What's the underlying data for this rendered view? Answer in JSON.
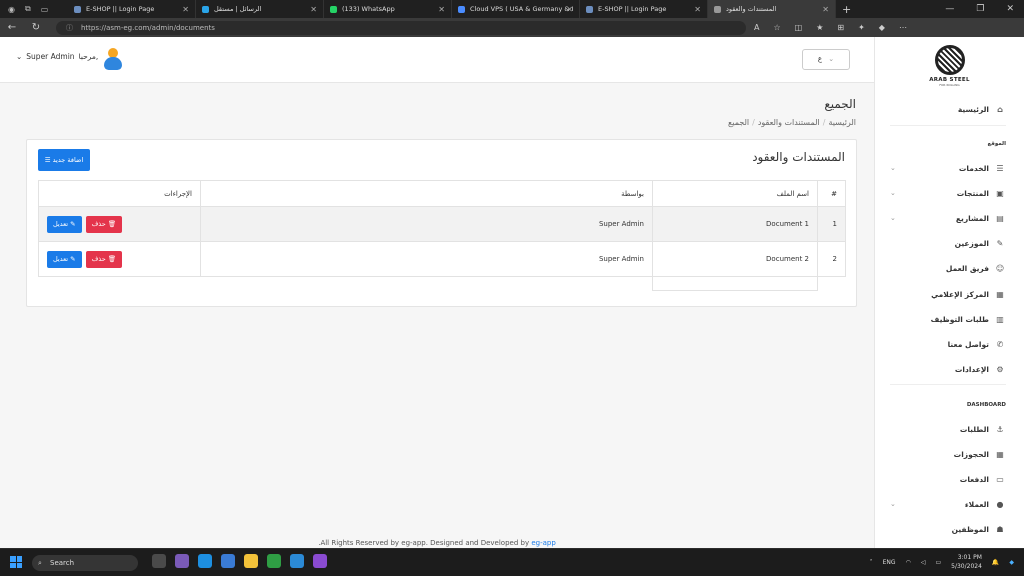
{
  "browser": {
    "tabs": [
      {
        "title": "E-SHOP || Login Page",
        "color": "#6c8ebf",
        "active": false
      },
      {
        "title": "الرسائل | مستقل",
        "color": "#2aa4e8",
        "active": false
      },
      {
        "title": "(133) WhatsApp",
        "color": "#25d366",
        "active": false
      },
      {
        "title": "Cloud VPS ( USA & Germany & I",
        "color": "#4a8cff",
        "active": false
      },
      {
        "title": "E-SHOP || Login Page",
        "color": "#6c8ebf",
        "active": false
      },
      {
        "title": "المستندات والعقود",
        "color": "#999999",
        "active": true
      }
    ],
    "url": "https://asm-eg.com/admin/documents"
  },
  "header": {
    "user_name": "Super Admin",
    "greeting": "مرحبا,",
    "language": "ع"
  },
  "page": {
    "title": "الجميع",
    "breadcrumb": [
      "الرئيسية",
      "المستندات والعقود",
      "الجميع"
    ]
  },
  "card": {
    "title": "المستندات والعقود",
    "add_button": "اضافة جديد",
    "columns": [
      "#",
      "اسم الملف",
      "بواسطة",
      "الإجراءات"
    ],
    "rows": [
      {
        "num": "1",
        "file": "Document 1",
        "by": "Super Admin",
        "edit": "تعديل",
        "delete": "حذف"
      },
      {
        "num": "2",
        "file": "Document 2",
        "by": "Super Admin",
        "edit": "تعديل",
        "delete": "حذف"
      }
    ]
  },
  "sidebar": {
    "logo_name": "ARAB STEEL",
    "logo_sub": "FOR ROLLING",
    "home": "الرئيسية",
    "section_site": "الموقع",
    "items": [
      {
        "label": "الخدمات",
        "icon": "list-icon",
        "glyph": "☰",
        "chevron": true
      },
      {
        "label": "المنتجات",
        "icon": "box-icon",
        "glyph": "▣",
        "chevron": true
      },
      {
        "label": "المشاريع",
        "icon": "briefcase-icon",
        "glyph": "▤",
        "chevron": true
      },
      {
        "label": "الموزعين",
        "icon": "pen-icon",
        "glyph": "✎",
        "chevron": false
      },
      {
        "label": "فريق العمل",
        "icon": "people-icon",
        "glyph": "☺",
        "chevron": false
      },
      {
        "label": "المركز الإعلامي",
        "icon": "media-icon",
        "glyph": "▦",
        "chevron": false
      },
      {
        "label": "طلبات التوظيف",
        "icon": "clipboard-icon",
        "glyph": "▥",
        "chevron": false
      },
      {
        "label": "تواصل معنا",
        "icon": "phone-icon",
        "glyph": "✆",
        "chevron": false
      },
      {
        "label": "الإعدادات",
        "icon": "gear-icon",
        "glyph": "⚙",
        "chevron": false
      }
    ],
    "section_dashboard": "DASHBOARD",
    "dashboard_items": [
      {
        "label": "الطلبات",
        "icon": "order-icon",
        "glyph": "⚓",
        "chevron": false
      },
      {
        "label": "الحجوزات",
        "icon": "calendar-icon",
        "glyph": "▦",
        "chevron": false
      },
      {
        "label": "الدفعات",
        "icon": "card-icon",
        "glyph": "▭",
        "chevron": false
      },
      {
        "label": "العملاء",
        "icon": "user-icon",
        "glyph": "●",
        "chevron": true
      },
      {
        "label": "الموظفين",
        "icon": "users-icon",
        "glyph": "☗",
        "chevron": false
      }
    ]
  },
  "footer": {
    "text": ".All Rights Reserved by eg-app. Designed and Developed by",
    "link": "eg-app"
  },
  "taskbar": {
    "search": "Search",
    "lang": "ENG",
    "time": "3:01 PM",
    "date": "5/30/2024"
  }
}
